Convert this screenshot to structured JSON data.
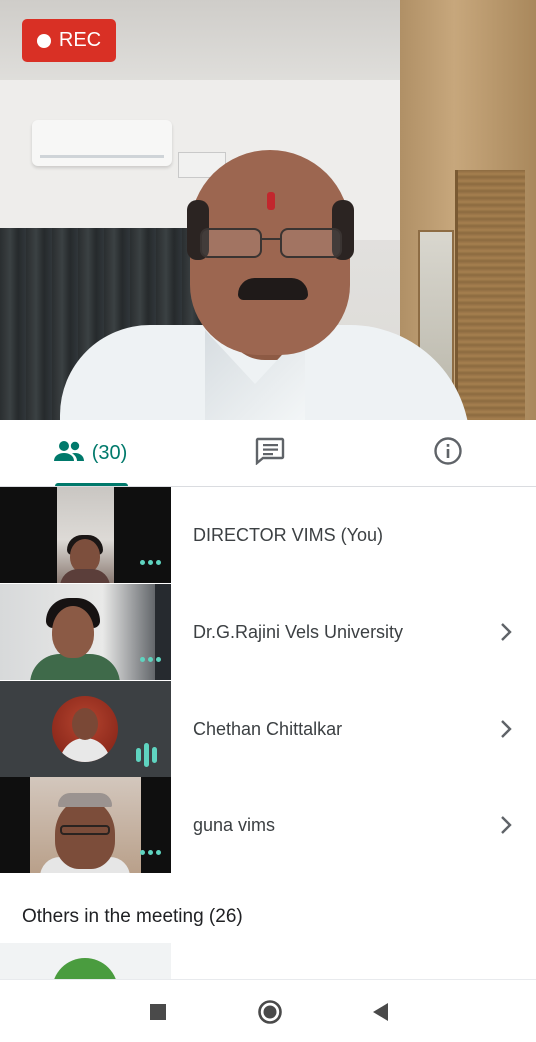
{
  "recording": {
    "label": "REC",
    "color": "#d93025"
  },
  "tabs": {
    "people": {
      "icon": "people-icon",
      "count": "(30)",
      "active": true
    },
    "chat": {
      "icon": "chat-icon"
    },
    "info": {
      "icon": "info-icon"
    }
  },
  "participants": [
    {
      "name": "DIRECTOR VIMS (You)",
      "tile": "video",
      "indicator": "more-dots",
      "has_chevron": false
    },
    {
      "name": "Dr.G.Rajini Vels University",
      "tile": "video",
      "indicator": "more-dots",
      "has_chevron": true
    },
    {
      "name": "Chethan Chittalkar",
      "tile": "avatar",
      "indicator": "audio-bars",
      "has_chevron": true
    },
    {
      "name": "guna vims",
      "tile": "video",
      "indicator": "more-dots",
      "has_chevron": true
    }
  ],
  "others": {
    "heading": "Others in the meeting (26)"
  },
  "navbar": {
    "icons": [
      "recents-icon",
      "home-icon",
      "back-icon"
    ]
  },
  "colors": {
    "accent": "#00796b",
    "indicator": "#5fd4c0",
    "text": "#3c4043"
  }
}
